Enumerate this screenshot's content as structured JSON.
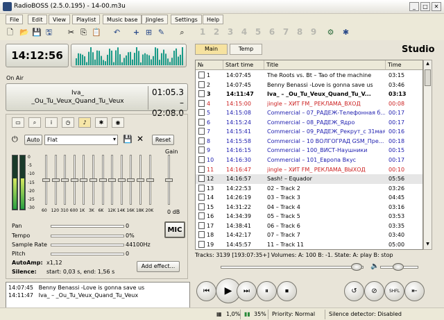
{
  "window": {
    "title": "RadioBOSS (2.5.0.195) - 14-00.m3u",
    "minimize": "_",
    "maximize": "□",
    "close": "✕"
  },
  "menu": [
    "File",
    "Edit",
    "View",
    "Playlist",
    "Music base",
    "Jingles",
    "Settings",
    "Help"
  ],
  "toolbar": {
    "icons": [
      "new-file-icon",
      "open-folder-icon",
      "save-icon",
      "save-as-icon",
      "cut-icon",
      "copy-icon",
      "paste-icon",
      "undo-icon",
      "add-icon",
      "add-track-icon",
      "edit-icon",
      "find-icon"
    ],
    "playlist_numbers": [
      "1",
      "2",
      "3",
      "4",
      "5",
      "6",
      "7",
      "8",
      "9"
    ],
    "extra_icons": [
      "scheduler-icon",
      "tools-icon"
    ]
  },
  "clock": "14:12:56",
  "on_air_label": "On Air",
  "now_playing": {
    "line1": "Iva_",
    "line2": "_Ou_Tu_Veux_Quand_Tu_Veux",
    "elapsed": "01:05.3",
    "remaining": "– 02:08.0"
  },
  "equalizer": {
    "auto_label": "Auto",
    "preset": "Flat",
    "reset_label": "Reset",
    "gain_label": "Gain",
    "gain_value": "0 dB",
    "db_scale": [
      "0",
      "-5",
      "-10",
      "-15",
      "-20",
      "-25",
      "-30"
    ],
    "bands": [
      "60",
      "120",
      "310",
      "600",
      "1K",
      "3K",
      "6K",
      "12K",
      "14K",
      "16K",
      "18K",
      "20K"
    ]
  },
  "controls": [
    {
      "label": "Pan",
      "value": "0"
    },
    {
      "label": "Tempo",
      "value": "0%"
    },
    {
      "label": "Sample Rate",
      "value": "44100Hz"
    },
    {
      "label": "Pitch",
      "value": "0"
    }
  ],
  "mic_label": "MIC",
  "autoamp": {
    "label": "AutoAmp:",
    "value": "x1,12"
  },
  "silence": {
    "label": "Silence:",
    "value": "start: 0,03 s,   end: 1,56 s"
  },
  "add_effect_label": "Add effect...",
  "history": [
    {
      "time": "14:07:45",
      "title": "Benny Benassi -Love is gonna save us"
    },
    {
      "time": "14:11:47",
      "title": "Iva_ – _Ou_Tu_Veux_Quand_Tu_Veux"
    }
  ],
  "tabs": {
    "main": "Main",
    "temp": "Temp"
  },
  "studio_label": "Studio",
  "playlist": {
    "columns": [
      "№",
      "Start time",
      "Title",
      "Time"
    ],
    "rows": [
      {
        "n": "1",
        "start": "14:07:45",
        "title": "The Roots vs. Bt – Tao of the machine",
        "time": "03:15",
        "style": "normal"
      },
      {
        "n": "2",
        "start": "14:07:45",
        "title": "Benny Benassi -Love is gonna save us",
        "time": "03:46",
        "style": "normal"
      },
      {
        "n": "3",
        "start": "14:11:47",
        "title": "Iva_ – _Ou_Tu_Veux_Quand_Tu_V...",
        "time": "03:13",
        "style": "bold"
      },
      {
        "n": "4",
        "start": "14:15:00",
        "title": "jingle – ХИТ FM_ РЕКЛАМА_ВХОД",
        "time": "00:08",
        "style": "red"
      },
      {
        "n": "5",
        "start": "14:15:08",
        "title": "Commercial – 07_РАДЕЖ-Телефонная б...",
        "time": "00:17",
        "style": "blue"
      },
      {
        "n": "6",
        "start": "14:15:24",
        "title": "Commercial – 08_РАДЕЖ_Ядро",
        "time": "00:17",
        "style": "blue"
      },
      {
        "n": "7",
        "start": "14:15:41",
        "title": "Commercial – 09_РАДЕЖ_Рекрут_с 31мая",
        "time": "00:16",
        "style": "blue"
      },
      {
        "n": "8",
        "start": "14:15:58",
        "title": "Commercial – 10 ВОЛГОГРАД GSM_Пре...",
        "time": "00:18",
        "style": "blue"
      },
      {
        "n": "9",
        "start": "14:16:15",
        "title": "Commercial – 100_ВИСТ-Наушники",
        "time": "00:15",
        "style": "blue"
      },
      {
        "n": "10",
        "start": "14:16:30",
        "title": "Commercial – 101_Европа Вкус",
        "time": "00:17",
        "style": "blue"
      },
      {
        "n": "11",
        "start": "14:16:47",
        "title": "jingle – ХИТ FM_ РЕКЛАМА_ВЫХОД",
        "time": "00:10",
        "style": "red"
      },
      {
        "n": "12",
        "start": "14:16:57",
        "title": "Sash! – Equador",
        "time": "05:56",
        "style": "selected"
      },
      {
        "n": "13",
        "start": "14:22:53",
        "title": "02 – Track 2",
        "time": "03:26",
        "style": "normal"
      },
      {
        "n": "14",
        "start": "14:26:19",
        "title": "03 – Track 3",
        "time": "04:45",
        "style": "normal"
      },
      {
        "n": "15",
        "start": "14:31:22",
        "title": "04 – Track 4",
        "time": "03:16",
        "style": "normal"
      },
      {
        "n": "16",
        "start": "14:34:39",
        "title": "05 – Track 5",
        "time": "03:53",
        "style": "normal"
      },
      {
        "n": "17",
        "start": "14:38:41",
        "title": "06 – Track 6",
        "time": "03:35",
        "style": "normal"
      },
      {
        "n": "18",
        "start": "14:42:17",
        "title": "07 – Track 7",
        "time": "03:40",
        "style": "normal"
      },
      {
        "n": "19",
        "start": "14:45:57",
        "title": "11 – Track 11",
        "time": "05:00",
        "style": "normal"
      }
    ]
  },
  "playlist_status": "Tracks: 3139 [193:07:35+]      Volumes: A: 100 B: -1. State: A: play B: stop",
  "transport": [
    "⏮",
    "▶",
    "⏭",
    "⏸",
    "⏹",
    "↺",
    "⊘",
    "SHFL",
    "⇤"
  ],
  "statusbar": {
    "cpu": "1,0%",
    "buffer": "35%",
    "priority": "Priority: Normal",
    "silence_detector": "Silence detector: Disabled"
  },
  "colors": {
    "red": "#cc2020",
    "blue": "#2020b0",
    "selected_bg": "#e6e6e6",
    "lcd_green": "#1a9a88"
  }
}
